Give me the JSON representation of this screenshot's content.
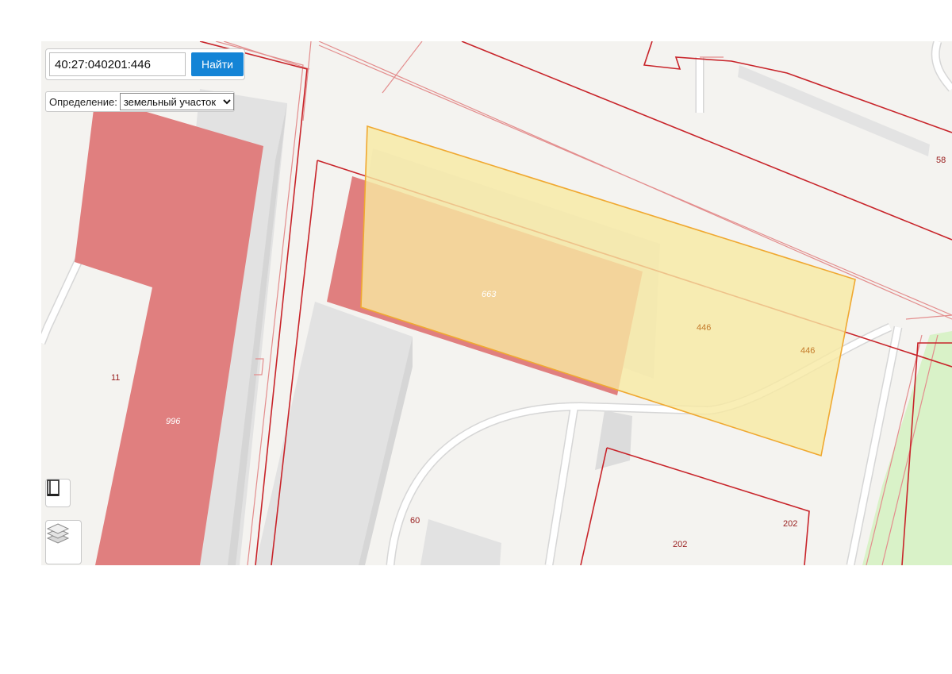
{
  "search": {
    "value": "40:27:040201:446",
    "button_label": "Найти"
  },
  "definition": {
    "label": "Определение:",
    "selected": "земельный участок"
  },
  "map": {
    "labels": {
      "lbl_663": "663",
      "lbl_446a": "446",
      "lbl_446b": "446",
      "lbl_996": "996",
      "lbl_11": "11",
      "lbl_60": "60",
      "lbl_202a": "202",
      "lbl_202b": "202",
      "lbl_58": "58"
    },
    "colors": {
      "building_fill": "#e07f7f",
      "selected_parcel_fill": "#f7eaa3",
      "selected_parcel_border": "#f0a830",
      "cadastral_boundary": "#c8242a",
      "thin_line": "#e38d8d",
      "shadow_building": "#e1e1e1",
      "green_zone": "#d9f2c8",
      "button": "#1484d6"
    }
  },
  "tools": {
    "legend_icon": "book-icon",
    "layers_icon": "layers-icon"
  }
}
